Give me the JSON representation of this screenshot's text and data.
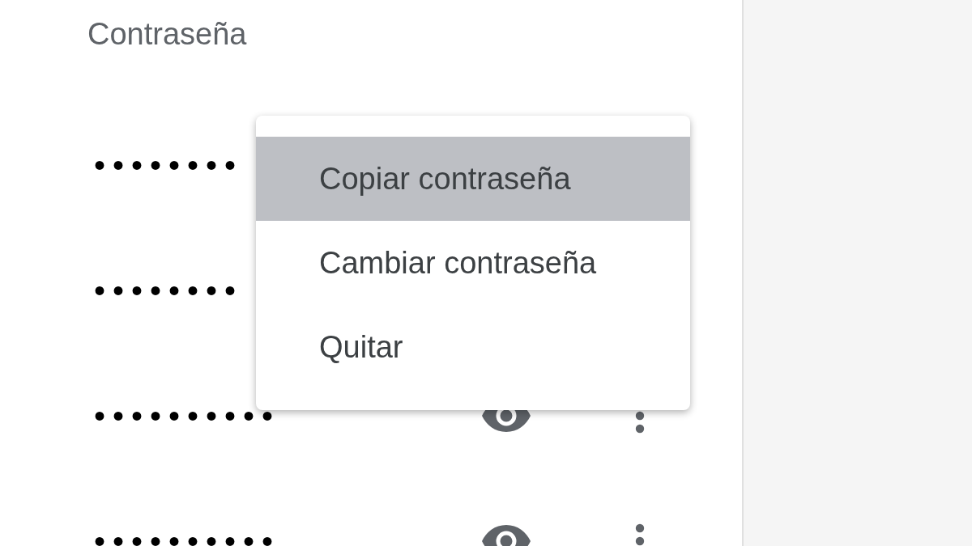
{
  "column_header": "Contraseña",
  "rows": [
    {
      "password": "••••••••",
      "actions_shown": false
    },
    {
      "password": "••••••••",
      "actions_shown": false
    },
    {
      "password": "••••••••••",
      "actions_shown": true
    },
    {
      "password": "••••••••••",
      "actions_shown": true
    }
  ],
  "context_menu": {
    "items": [
      {
        "label": "Copiar contraseña",
        "selected": true
      },
      {
        "label": "Cambiar contraseña",
        "selected": false
      },
      {
        "label": "Quitar",
        "selected": false
      }
    ]
  }
}
